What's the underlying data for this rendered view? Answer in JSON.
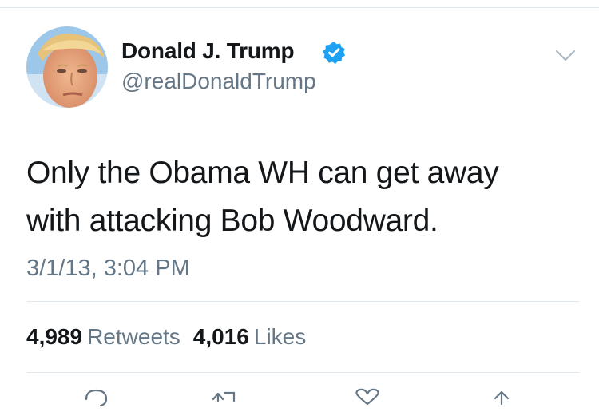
{
  "author": {
    "name": "Donald J. Trump",
    "handle": "@realDonaldTrump",
    "verified": true
  },
  "tweet": {
    "text": "Only the Obama WH can get away\nwith attacking Bob Woodward.",
    "timestamp": "3/1/13, 3:04 PM"
  },
  "stats": {
    "retweets_count": "4,989",
    "retweets_label": "Retweets",
    "likes_count": "4,016",
    "likes_label": "Likes"
  },
  "icons": {
    "verified": "verified-badge-icon",
    "menu": "chevron-down-icon",
    "reply": "reply-icon",
    "retweet": "retweet-icon",
    "like": "heart-icon",
    "share": "share-icon"
  },
  "colors": {
    "text": "#14171a",
    "secondary": "#657786",
    "verified": "#1da1f2",
    "divider": "#e1e8ed"
  }
}
